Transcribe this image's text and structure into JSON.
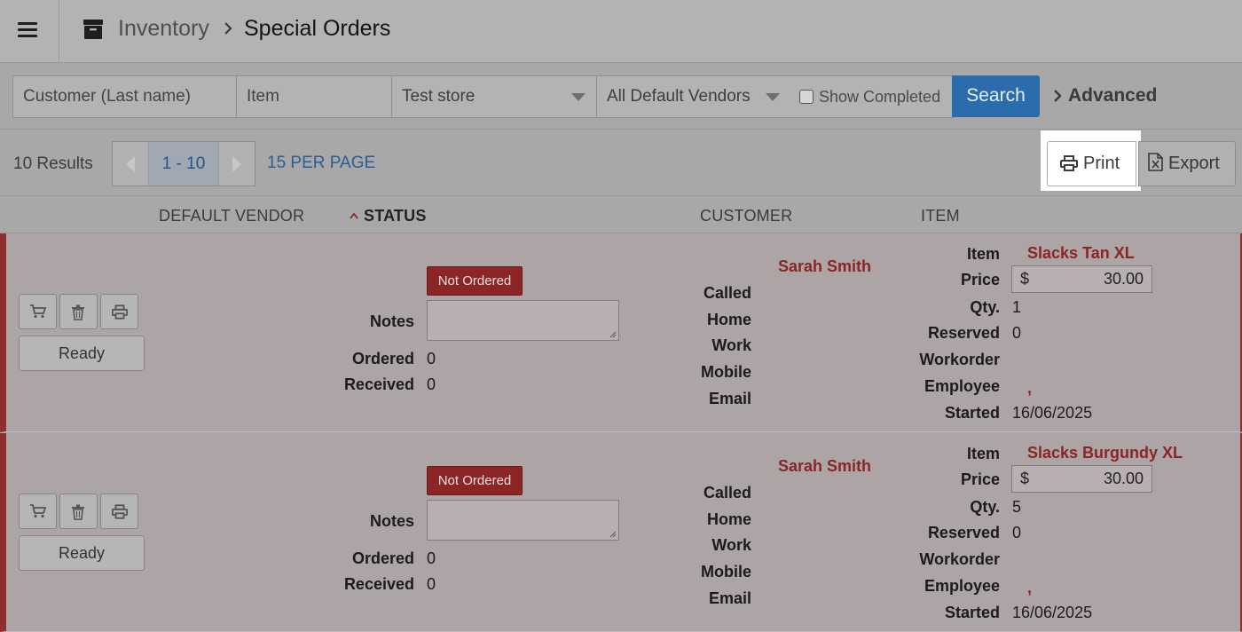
{
  "header": {
    "breadcrumb_parent": "Inventory",
    "breadcrumb_current": "Special Orders"
  },
  "filters": {
    "customer_placeholder": "Customer (Last name)",
    "item_placeholder": "Item",
    "store_value": "Test store",
    "vendor_value": "All Default Vendors",
    "show_completed_label": "Show Completed",
    "show_completed_checked": false,
    "search_label": "Search",
    "advanced_label": "Advanced"
  },
  "toolbar": {
    "results_text": "10 Results",
    "page_range": "1 - 10",
    "per_page": "15 PER PAGE",
    "print_label": "Print",
    "export_label": "Export"
  },
  "columns": {
    "default_vendor": "DEFAULT VENDOR",
    "status": "STATUS",
    "customer": "CUSTOMER",
    "item": "ITEM"
  },
  "labels": {
    "ready": "Ready",
    "notes": "Notes",
    "ordered": "Ordered",
    "received": "Received",
    "called": "Called",
    "home": "Home",
    "work": "Work",
    "mobile": "Mobile",
    "email": "Email",
    "item": "Item",
    "price": "Price",
    "qty": "Qty.",
    "reserved": "Reserved",
    "workorder": "Workorder",
    "employee": "Employee",
    "started": "Started",
    "currency": "$"
  },
  "orders": [
    {
      "status": "Not Ordered",
      "ordered": "0",
      "received": "0",
      "customer": "Sarah Smith",
      "item": "Slacks Tan XL",
      "price": "30.00",
      "qty": "1",
      "reserved": "0",
      "employee": ",",
      "started": "16/06/2025"
    },
    {
      "status": "Not Ordered",
      "ordered": "0",
      "received": "0",
      "customer": "Sarah Smith",
      "item": "Slacks Burgundy XL",
      "price": "30.00",
      "qty": "5",
      "reserved": "0",
      "employee": ",",
      "started": "16/06/2025"
    }
  ],
  "colors": {
    "accent_blue": "#2b6cad",
    "status_red": "#8c2626",
    "row_border": "#8f2e2e"
  }
}
